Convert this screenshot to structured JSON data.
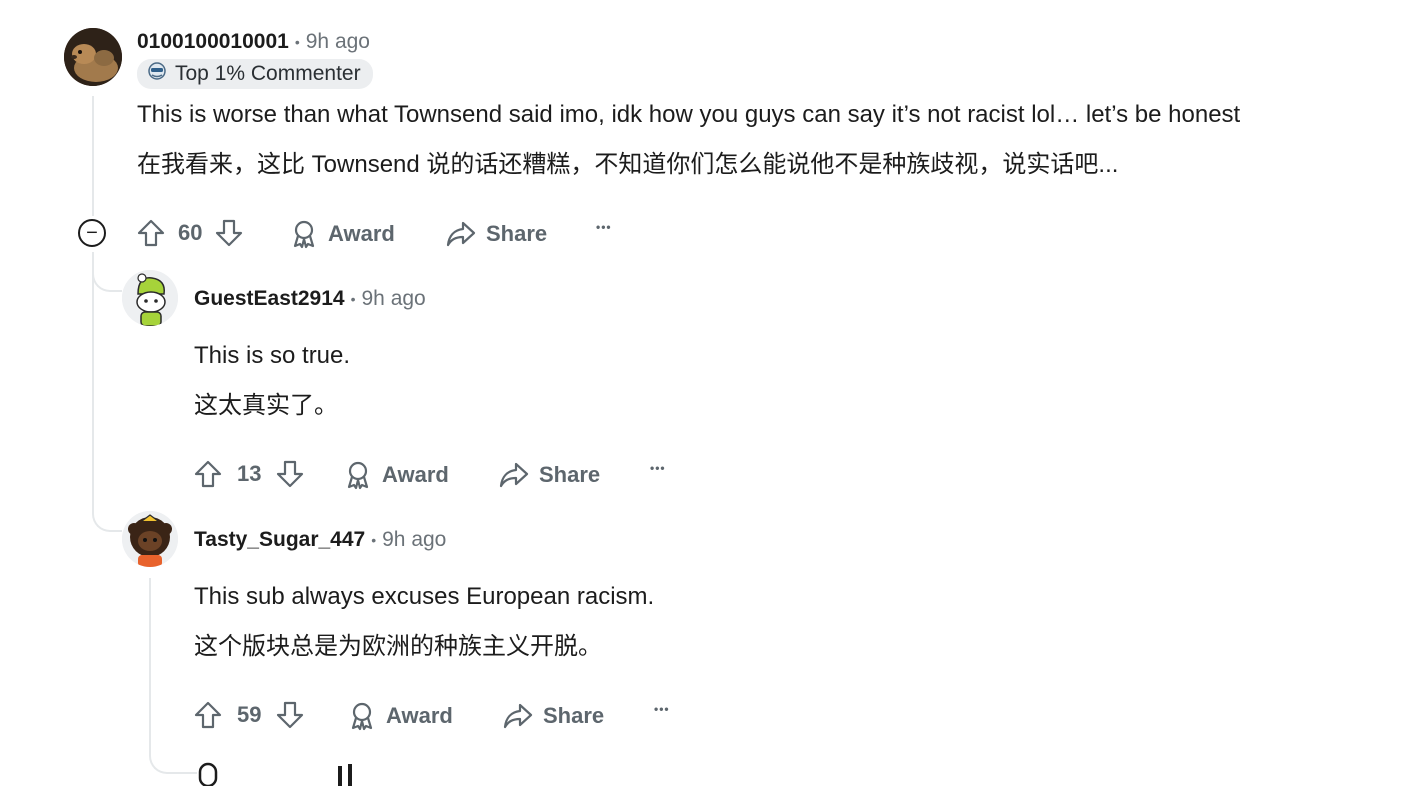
{
  "comments": [
    {
      "username": "0100100010001",
      "time": "9h ago",
      "badge": "Top 1% Commenter",
      "text_en": "This is worse than what Townsend said imo, idk how you guys can say it’s not racist lol… let’s be honest",
      "text_zh": "在我看来，这比 Townsend 说的话还糟糕，不知道你们怎么能说他不是种族歧视，说实话吧...",
      "votes": "60",
      "award_label": "Award",
      "share_label": "Share",
      "more_label": "•••"
    },
    {
      "username": "GuestEast2914",
      "time": "9h ago",
      "text_en": "This is so true.",
      "text_zh": "这太真实了。",
      "votes": "13",
      "award_label": "Award",
      "share_label": "Share",
      "more_label": "•••"
    },
    {
      "username": "Tasty_Sugar_447",
      "time": "9h ago",
      "text_en": "This sub always excuses European racism.",
      "text_zh": "这个版块总是为欧洲的种族主义开脱。",
      "votes": "59",
      "award_label": "Award",
      "share_label": "Share",
      "more_label": "•••"
    }
  ],
  "separator": "•",
  "collapse_symbol": "−",
  "colors": {
    "text": "#1c1c1c",
    "meta": "#6b7278",
    "action": "#5d666d",
    "thread_line": "#e5e8ea",
    "badge_bg": "#eceef0"
  }
}
